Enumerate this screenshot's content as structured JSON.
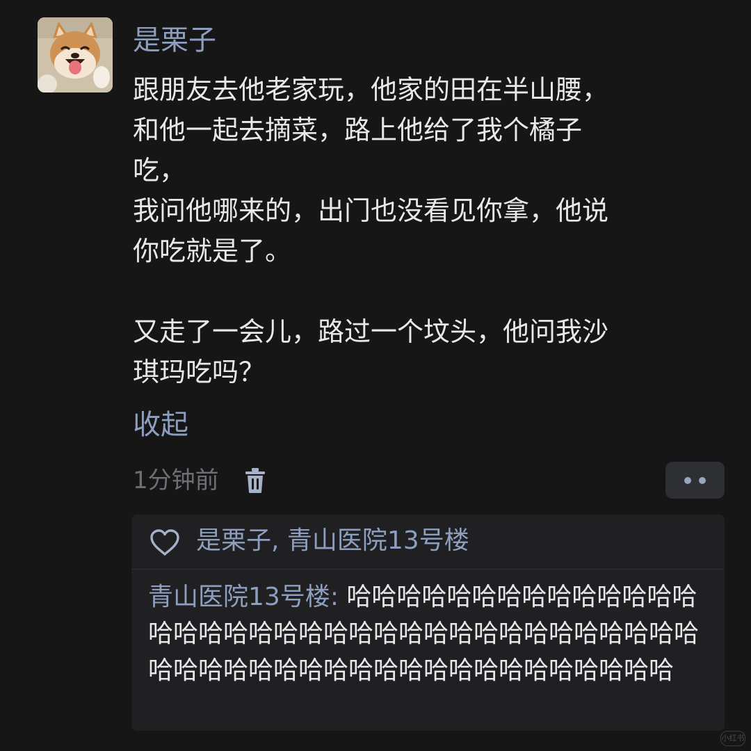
{
  "post": {
    "author": "是栗子",
    "lines": [
      "跟朋友去他老家玩，他家的田在半山腰，",
      "和他一起去摘菜，路上他给了我个橘子",
      "吃，",
      "我问他哪来的，出门也没看见你拿，他说",
      "你吃就是了。",
      "",
      "又走了一会儿，路过一个坟头，他问我沙",
      "琪玛吃吗？"
    ],
    "collapse_label": "收起",
    "time": "1分钟前",
    "avatar_icon": "shiba-dog-avatar",
    "delete_icon": "trash-icon",
    "more_icon": "more-dots-icon"
  },
  "reply_panel": {
    "like_icon": "heart-icon",
    "likers": "是栗子, 青山医院13号楼",
    "reply": {
      "author": "青山医院13号楼",
      "separator": ": ",
      "text": "哈哈哈哈哈哈哈哈哈哈哈哈哈哈哈哈哈哈哈哈哈哈哈哈哈哈哈哈哈哈哈哈哈哈哈哈哈哈哈哈哈哈哈哈哈哈哈哈哈哈哈哈哈哈哈哈哈"
    }
  },
  "watermark": "小红书",
  "colors": {
    "background": "#161617",
    "link_blue": "#8d9fbe",
    "body_text": "#e8e8e8",
    "muted_text": "#6d6f74",
    "panel_bg": "#202023"
  }
}
